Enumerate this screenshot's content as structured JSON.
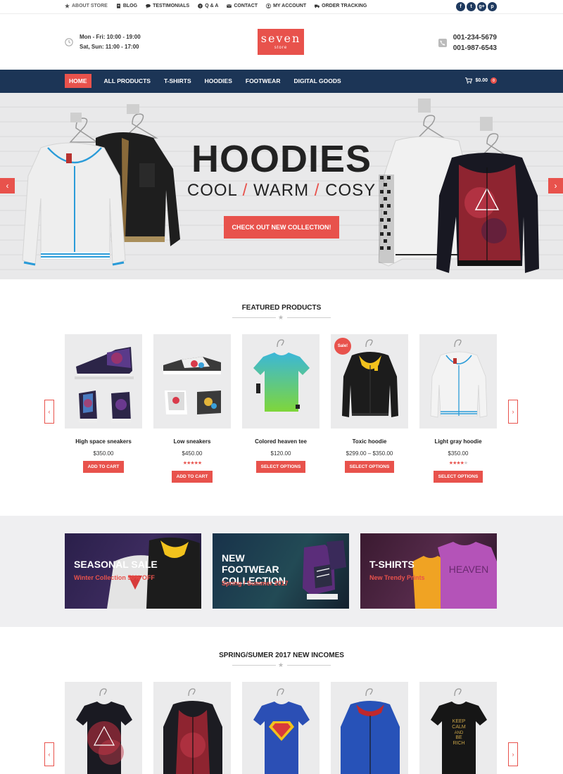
{
  "topbar": {
    "links": [
      {
        "label": "ABOUT STORE",
        "icon": "star-icon"
      },
      {
        "label": "BLOG",
        "icon": "document-icon"
      },
      {
        "label": "TESTIMONIALS",
        "icon": "speech-bubble-icon"
      },
      {
        "label": "Q & A",
        "icon": "question-icon"
      },
      {
        "label": "CONTACT",
        "icon": "envelope-icon"
      },
      {
        "label": "MY ACCOUNT",
        "icon": "user-icon"
      },
      {
        "label": "ORDER TRACKING",
        "icon": "truck-icon"
      }
    ],
    "social": [
      {
        "glyph": "f",
        "icon": "facebook-icon"
      },
      {
        "glyph": "t",
        "icon": "twitter-icon"
      },
      {
        "glyph": "g+",
        "icon": "google-plus-icon"
      },
      {
        "glyph": "p",
        "icon": "pinterest-icon"
      }
    ]
  },
  "header": {
    "hours": [
      "Mon - Fri: 10:00 - 19:00",
      "Sat, Sun: 11:00 - 17:00"
    ],
    "logo": {
      "main": "seven",
      "sub": "store"
    },
    "phones": [
      "001-234-5679",
      "001-987-6543"
    ]
  },
  "nav": {
    "items": [
      "HOME",
      "ALL PRODUCTS",
      "T-SHIRTS",
      "HOODIES",
      "FOOTWEAR",
      "DIGITAL GOODS"
    ],
    "active": "HOME",
    "cart_total": "$0.00",
    "cart_count": "0"
  },
  "hero": {
    "title": "HOODIES",
    "subtitle": [
      "COOL",
      "WARM",
      "COSY"
    ],
    "separator": "/",
    "button": "CHECK OUT NEW COLLECTION!",
    "prev": "‹",
    "next": "›"
  },
  "featured": {
    "title": "FEATURED PRODUCTS",
    "products": [
      {
        "name": "High space sneakers",
        "price": "$350.00",
        "button": "ADD TO CART",
        "rating": 0,
        "sale": ""
      },
      {
        "name": "Low sneakers",
        "price": "$450.00",
        "button": "ADD TO CART",
        "rating": 5,
        "sale": ""
      },
      {
        "name": "Colored heaven tee",
        "price": "$120.00",
        "button": "SELECT OPTIONS",
        "rating": 0,
        "sale": ""
      },
      {
        "name": "Toxic hoodie",
        "price": "$299.00 – $350.00",
        "button": "SELECT OPTIONS",
        "rating": 0,
        "sale": "Sale!"
      },
      {
        "name": "Light gray hoodie",
        "price": "$350.00",
        "button": "SELECT OPTIONS",
        "rating": 4,
        "sale": ""
      }
    ],
    "prev": "‹",
    "next": "›"
  },
  "banners": [
    {
      "title": "SEASONAL SALE",
      "subtitle": "Winter Collection 50% OFF"
    },
    {
      "title": "NEW FOOTWEAR COLLECTION",
      "subtitle": "Spring / Summer 2017"
    },
    {
      "title": "T-SHIRTS",
      "subtitle": "New Trendy Prints"
    }
  ],
  "spring": {
    "title": "SPRING/SUMER 2017 NEW INCOMES",
    "prev": "‹",
    "next": "›"
  },
  "colors": {
    "accent": "#e8524c",
    "nav_bg": "#1c3556",
    "promo_bg": "#efeff1"
  }
}
